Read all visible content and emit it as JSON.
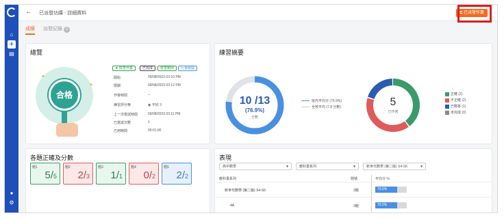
{
  "topbar": {
    "back": "←",
    "breadcrumb": "已派發功課 - 詳細資料",
    "create_button": "已派發作業"
  },
  "tabs": [
    {
      "label": "成績"
    },
    {
      "label": "派發記錄",
      "badge": "0"
    }
  ],
  "overview": {
    "title": "總覽",
    "result_label": "合格",
    "status_badges": [
      {
        "label": "★ 檢查作業",
        "color": "#2fa34f"
      },
      {
        "label": "已完成",
        "color": "#444444"
      },
      {
        "label": "檢查範例",
        "color": "#2fa34f"
      },
      {
        "label": "行事曆提",
        "color": "#4a90e2"
      }
    ],
    "info": [
      {
        "label": "開始",
        "value": "09/08/2023 03:10 PM"
      },
      {
        "label": "限期",
        "value": "09/08/2023 03:12 PM"
      },
      {
        "label": "作答時間",
        "value": "--"
      },
      {
        "label": "練習評分等",
        "value": "◉ 不好 3"
      },
      {
        "label": "上一次嘗試時間",
        "value": "09/08/2023 03:11 PM"
      },
      {
        "label": "已嘗試次數",
        "value": "1"
      },
      {
        "label": "已用時間",
        "value": "00:01:00"
      }
    ]
  },
  "summary": {
    "title": "練習摘要",
    "score_main": "10 /13",
    "score_pct": "(76.9%)",
    "score_unit": "分數",
    "legend_lines": [
      {
        "label": "班內平均分 (76.9%)",
        "color": "#4a90e2"
      },
      {
        "label": "全校平均 (7.8 分數)",
        "color": "#cccccc"
      }
    ],
    "donut_count": "5",
    "donut_caption": "已作答",
    "legend_items": [
      {
        "label": "正確 (2)",
        "color": "#3a9a6a"
      },
      {
        "label": "不正確 (2)",
        "color": "#e05a5a"
      },
      {
        "label": "已略答 (1)",
        "color": "#2a5db0"
      },
      {
        "label": "未完成 (0)",
        "color": "#888888"
      }
    ]
  },
  "chart_data": {
    "type": "pie",
    "categories": [
      "正確",
      "不正確",
      "已略答",
      "未完成"
    ],
    "values": [
      2,
      2,
      1,
      0
    ],
    "colors": [
      "#3a9a6a",
      "#e05a5a",
      "#2a5db0",
      "#888888"
    ],
    "gauge": {
      "score": 10,
      "total": 13,
      "percent": 76.9
    }
  },
  "scores": {
    "title": "各題正確及分數",
    "items": [
      {
        "q": "題1",
        "num": "5",
        "den": "5",
        "border": "#3a9a6a",
        "bg": "#e9f6ee",
        "color": "#2f7d52"
      },
      {
        "q": "題2",
        "num": "2",
        "den": "3",
        "border": "#e05a5a",
        "bg": "#fde8e8",
        "color": "#c04545"
      },
      {
        "q": "題3",
        "num": "1",
        "den": "1",
        "border": "#3a9a6a",
        "bg": "#e9f6ee",
        "color": "#2f7d52"
      },
      {
        "q": "題4",
        "num": "0",
        "den": "2",
        "border": "#e05a5a",
        "bg": "#fde8e8",
        "color": "#c04545"
      },
      {
        "q": "題5",
        "num": "2",
        "den": "2",
        "border": "#4a90e2",
        "bg": "#e6f1fc",
        "color": "#3a78c0"
      }
    ]
  },
  "performance": {
    "title": "表現",
    "dropdowns": [
      {
        "label": "高中數學"
      },
      {
        "label": "教科書系列"
      },
      {
        "label": "新世代數學 (第二版) S4-S6"
      }
    ],
    "columns": {
      "series": "教科書系列",
      "count": "題號",
      "avg": "平均分 %"
    },
    "rows": [
      {
        "series": "新世代數學 (第二版) S4-S6",
        "count": "3題",
        "pct": "70.0%",
        "ratio": 0.7
      },
      {
        "series": "4A",
        "count": "3題",
        "pct": "70.0%",
        "ratio": 0.7
      }
    ]
  }
}
